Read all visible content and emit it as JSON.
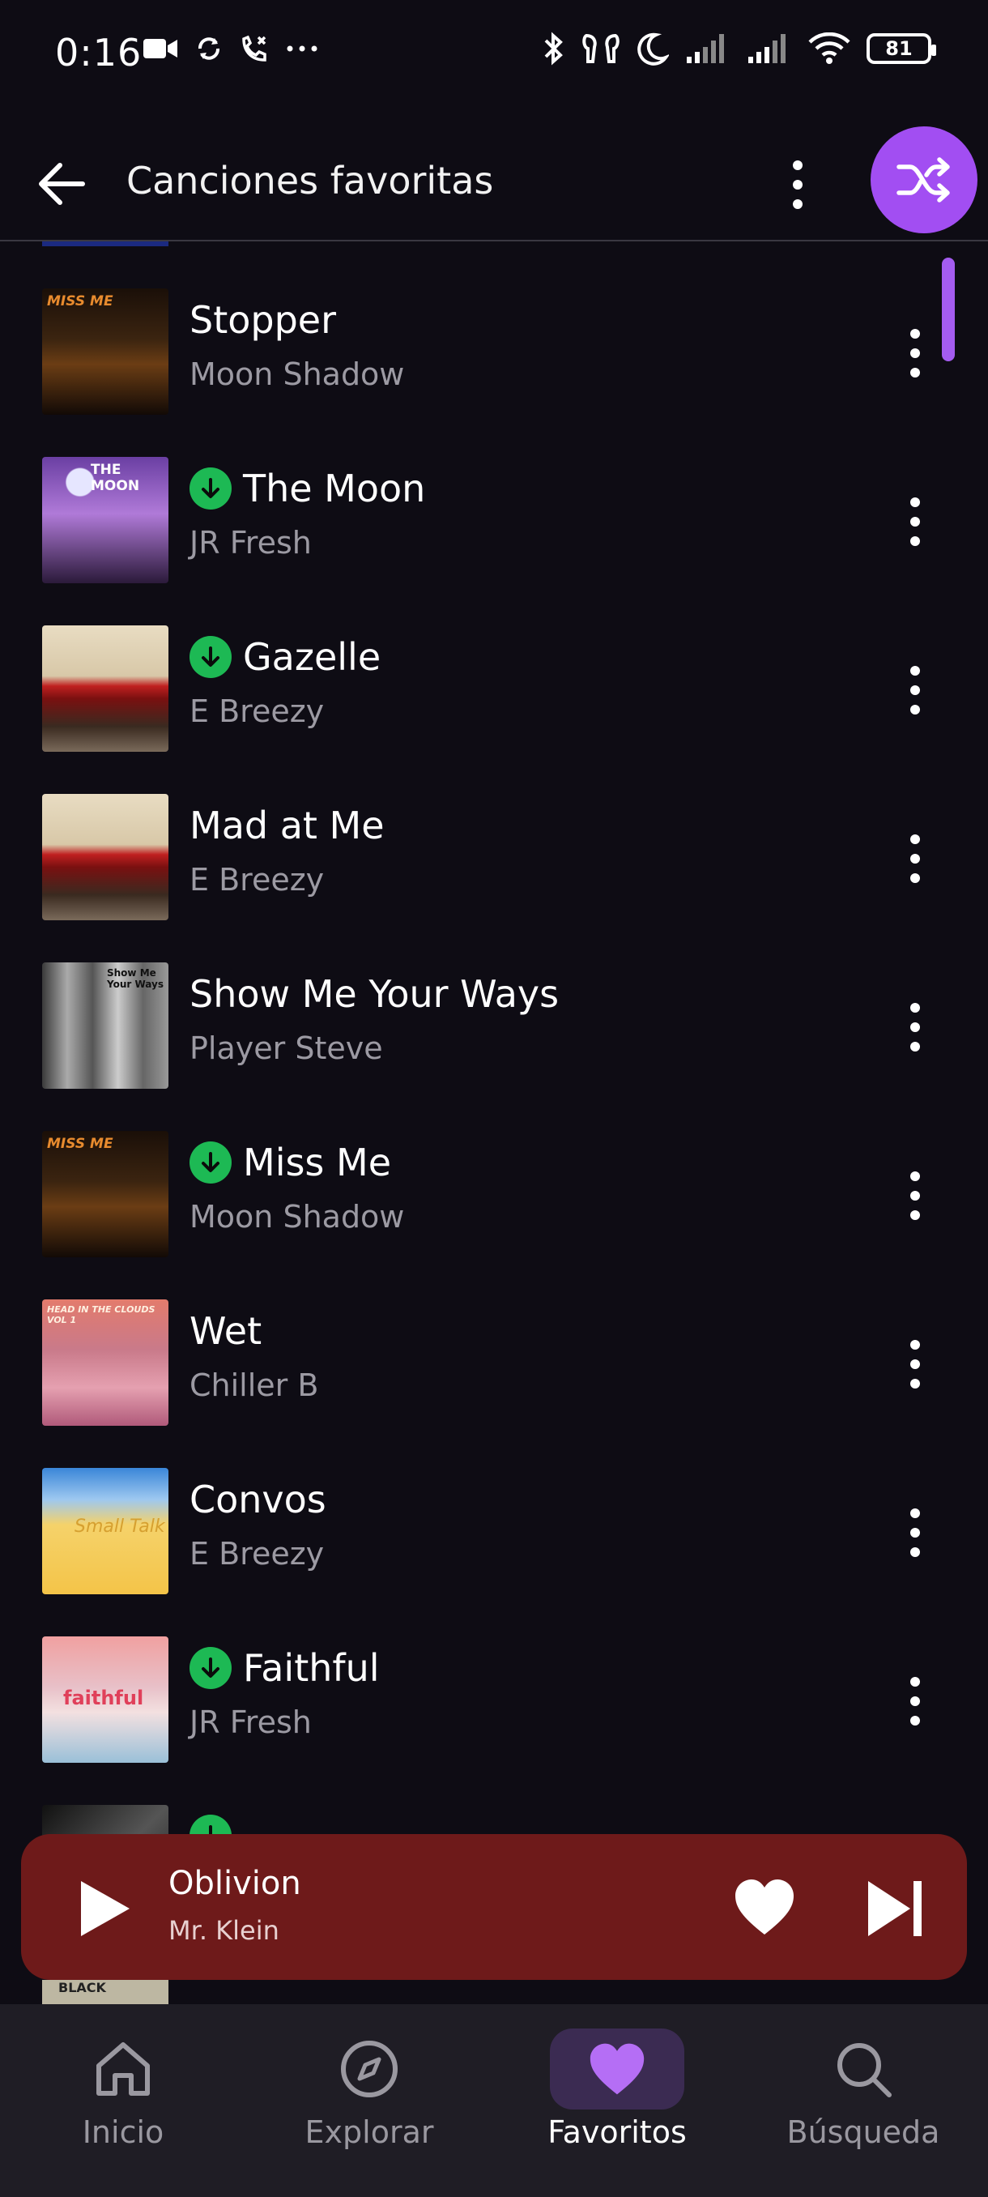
{
  "status_bar": {
    "time": "0:16",
    "battery": "81",
    "icons_left": [
      "video-camera-icon",
      "sync-icon",
      "missed-call-icon",
      "more-dots-icon"
    ],
    "icons_right": [
      "bluetooth-icon",
      "earbuds-icon",
      "moon-icon",
      "signal-icon",
      "signal-icon",
      "wifi-icon",
      "battery-icon"
    ]
  },
  "header": {
    "title": "Canciones favoritas",
    "back_icon": "arrow-left-icon",
    "more_icon": "more-vertical-icon",
    "shuffle_icon": "shuffle-icon",
    "accent": "#a24ef2"
  },
  "songs": [
    {
      "title": "Stopper",
      "artist": "Moon Shadow",
      "downloaded": false,
      "art_text": "MISS ME"
    },
    {
      "title": "The Moon",
      "artist": "JR Fresh",
      "downloaded": true,
      "art_text": "THE MOON"
    },
    {
      "title": "Gazelle",
      "artist": "E Breezy",
      "downloaded": true,
      "art_text": ""
    },
    {
      "title": "Mad at Me",
      "artist": "E Breezy",
      "downloaded": false,
      "art_text": ""
    },
    {
      "title": "Show Me Your Ways",
      "artist": "Player Steve",
      "downloaded": false,
      "art_text": "Show Me Your Ways"
    },
    {
      "title": "Miss Me",
      "artist": "Moon Shadow",
      "downloaded": true,
      "art_text": "MISS ME"
    },
    {
      "title": "Wet",
      "artist": "Chiller B",
      "downloaded": false,
      "art_text": "HEAD IN THE CLOUDS VOL 1"
    },
    {
      "title": "Convos",
      "artist": "E Breezy",
      "downloaded": false,
      "art_text": "Small Talk"
    },
    {
      "title": "Faithful",
      "artist": "JR Fresh",
      "downloaded": true,
      "art_text": "faithful"
    }
  ],
  "partial_row_art_text": "BLACK",
  "player": {
    "title": "Oblivion",
    "artist": "Mr. Klein",
    "background": "#6e1a1a"
  },
  "nav": {
    "items": [
      {
        "label": "Inicio",
        "icon": "home-icon",
        "active": false
      },
      {
        "label": "Explorar",
        "icon": "compass-icon",
        "active": false
      },
      {
        "label": "Favoritos",
        "icon": "heart-icon",
        "active": true
      },
      {
        "label": "Búsqueda",
        "icon": "search-icon",
        "active": false
      }
    ]
  },
  "colors": {
    "background": "#0e0c14",
    "download_badge": "#1db954",
    "secondary_text": "#9c9aa3"
  }
}
